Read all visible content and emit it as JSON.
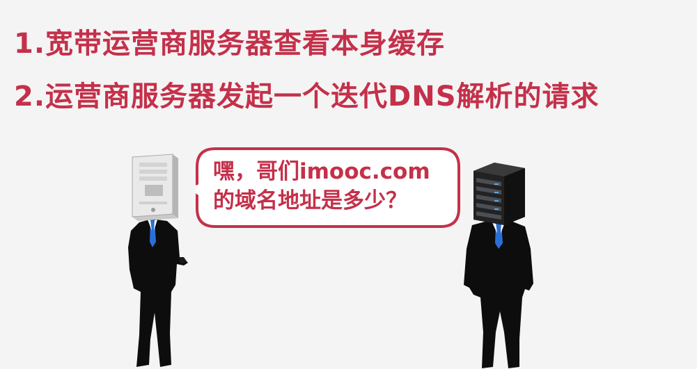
{
  "slide": {
    "line1": "1.宽带运营商服务器查看本身缓存",
    "line2": "2.运营商服务器发起一个迭代DNS解析的请求",
    "bubble_line1": "嘿，哥们imooc.com",
    "bubble_line2": "的域名地址是多少？"
  },
  "colors": {
    "accent": "#c4304a",
    "background": "#f4f4f4"
  }
}
